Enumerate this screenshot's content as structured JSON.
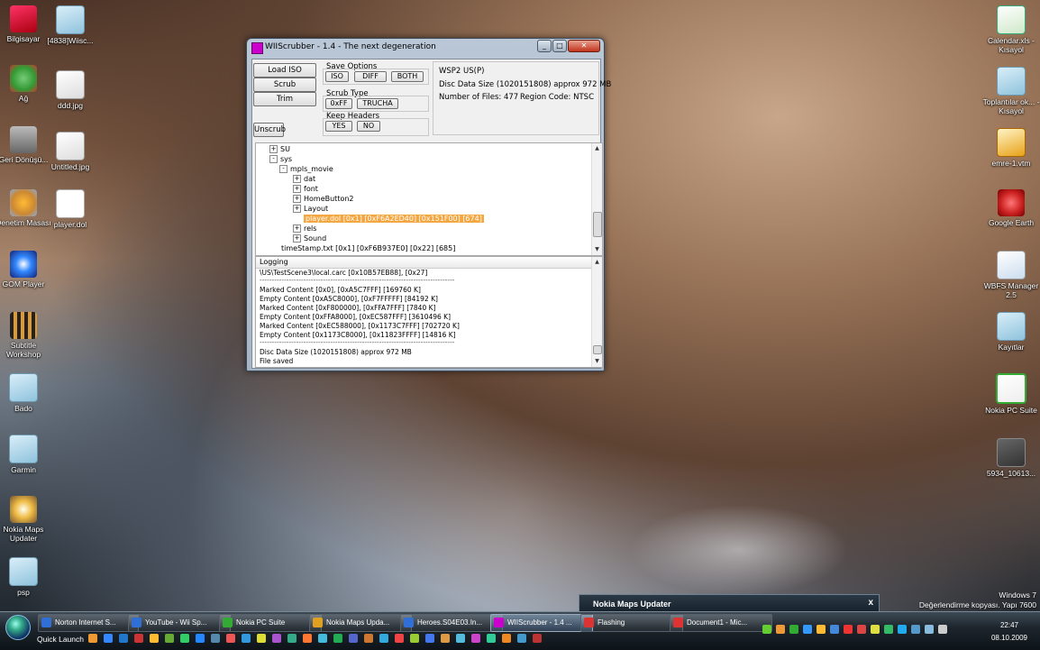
{
  "desktop_icons": [
    {
      "label": "Bilgisayar",
      "icon": "computer-icon"
    },
    {
      "label": "[4838]Wiisc...",
      "icon": "folder-icon"
    },
    {
      "label": "Ağ",
      "icon": "network-icon"
    },
    {
      "label": "ddd.jpg",
      "icon": "image-file-icon"
    },
    {
      "label": "Geri Dönüşü...",
      "icon": "recycle-bin-icon"
    },
    {
      "label": "Untitled.jpg",
      "icon": "image-file-icon"
    },
    {
      "label": "Denetim Masası",
      "icon": "control-panel-icon"
    },
    {
      "label": "player.dol",
      "icon": "file-icon"
    },
    {
      "label": "GOM Player",
      "icon": "gom-player-icon"
    },
    {
      "label": "Subtitle Workshop",
      "icon": "subtitle-workshop-icon"
    },
    {
      "label": "Bado",
      "icon": "folder-icon"
    },
    {
      "label": "Garmin",
      "icon": "folder-icon"
    },
    {
      "label": "Nokia Maps Updater",
      "icon": "nokia-maps-icon"
    },
    {
      "label": "psp",
      "icon": "folder-icon"
    },
    {
      "label": "Calendar.xls - Kısayol",
      "icon": "excel-file-icon"
    },
    {
      "label": "Toplantılar ok... - Kısayol",
      "icon": "shortcut-icon"
    },
    {
      "label": "emre-1.vtm",
      "icon": "vtm-file-icon"
    },
    {
      "label": "Google Earth",
      "icon": "google-earth-icon"
    },
    {
      "label": "WBFS Manager 2.5",
      "icon": "wbfs-manager-icon"
    },
    {
      "label": "Kayıtlar",
      "icon": "folder-icon"
    },
    {
      "label": "Nokia PC Suite",
      "icon": "nokia-pc-suite-icon"
    },
    {
      "label": "5934_10613...",
      "icon": "thumbnail-icon"
    }
  ],
  "window": {
    "title": "WIIScrubber - 1.4 - The next degeneration",
    "buttons": {
      "load_iso": "Load ISO",
      "scrub": "Scrub",
      "trim": "Trim",
      "unscrub": "Unscrub"
    },
    "save_options": {
      "label": "Save Options",
      "iso": "ISO",
      "diff": "DIFF",
      "both": "BOTH"
    },
    "scrub_type": {
      "label": "Scrub Type",
      "ff": "0xFF",
      "trucha": "TRUCHA"
    },
    "keep_headers": {
      "label": "Keep Headers",
      "yes": "YES",
      "no": "NO"
    },
    "info": {
      "game_id": "WSP2 US(P)",
      "disc_size": "Disc Data Size (1020151808) approx  972 MB",
      "num_files": "Number of Files: 477",
      "region": "Region Code: NTSC"
    },
    "tree": [
      {
        "label": "SU",
        "expander": "+"
      },
      {
        "label": "sys",
        "expander": "-"
      },
      {
        "label": "mpls_movie",
        "expander": "-"
      },
      {
        "label": "dat",
        "expander": "+"
      },
      {
        "label": "font",
        "expander": "+"
      },
      {
        "label": "HomeButton2",
        "expander": "+"
      },
      {
        "label": "Layout",
        "expander": "+"
      },
      {
        "label": "player.dol [0x1] [0xF6A2ED40] [0x151F00] [674]",
        "expander": ""
      },
      {
        "label": "rels",
        "expander": "+"
      },
      {
        "label": "Sound",
        "expander": "+"
      },
      {
        "label": "timeStamp.txt [0x1] [0xF6B937E0] [0x22] [685]",
        "expander": ""
      }
    ],
    "log_title": "Logging",
    "log_lines": [
      "\\US\\TestScene3\\local.carc [0x10B57EB88], [0x27]",
      "--------------------------------------------------------------------------------",
      "Marked Content [0x0], [0xA5C7FFF] [169760 K]",
      "Empty Content [0xA5C8000], [0xF7FFFFF] [84192 K]",
      "Marked Content [0xF800000], [0xFFA7FFF] [7840 K]",
      "Empty Content [0xFFA8000], [0xEC587FFF] [3610496 K]",
      "Marked Content [0xEC588000], [0x1173C7FFF] [702720 K]",
      "Empty Content [0x1173C8000], [0x11823FFFF] [14816 K]",
      "--------------------------------------------------------------------------------",
      "Disc Data Size (1020151808) approx  972 MB",
      "File saved"
    ]
  },
  "toast": {
    "title": "Nokia Maps Updater",
    "close": "x"
  },
  "watermark": {
    "line1": "Windows 7",
    "line2": "Değerlendirme kopyası. Yapı 7600"
  },
  "taskbar": {
    "quick_launch": "Quick Launch",
    "items": [
      {
        "label": "Norton Internet S...",
        "color": "#2f6fd6"
      },
      {
        "label": "YouTube - Wii Sp...",
        "color": "#2f6fd6"
      },
      {
        "label": "Nokia PC Suite",
        "color": "#3a3"
      },
      {
        "label": "Nokia Maps Upda...",
        "color": "#e0a020"
      },
      {
        "label": "Heroes.S04E03.In...",
        "color": "#2f6fd6"
      },
      {
        "label": "WIIScrubber - 1.4 ...",
        "color": "#c0c"
      },
      {
        "label": "Flashing",
        "color": "#d33"
      },
      {
        "label": "Document1 - Mic...",
        "color": "#d33"
      }
    ],
    "time": "22:47",
    "date": "08.10.2009"
  }
}
